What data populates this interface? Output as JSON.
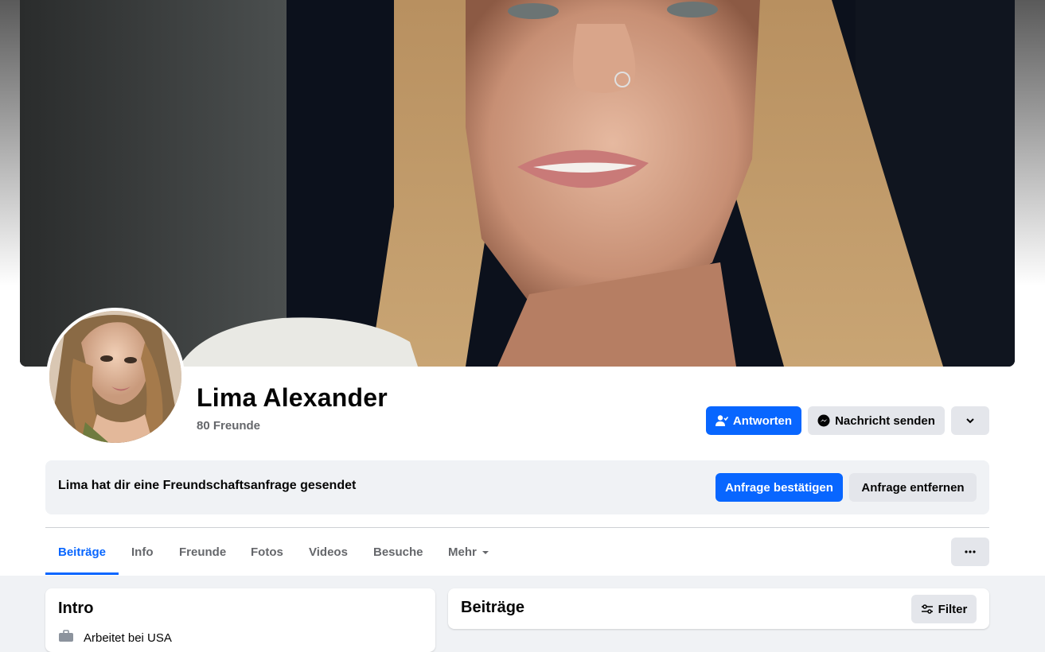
{
  "profile": {
    "name": "Lima Alexander",
    "friends_count": "80 Freunde"
  },
  "actions": {
    "reply_label": "Antworten",
    "message_label": "Nachricht senden"
  },
  "friend_request": {
    "text": "Lima hat dir eine Freundschaftsanfrage gesendet",
    "confirm_label": "Anfrage bestätigen",
    "remove_label": "Anfrage entfernen"
  },
  "tabs": [
    {
      "label": "Beiträge",
      "active": true
    },
    {
      "label": "Info",
      "active": false
    },
    {
      "label": "Freunde",
      "active": false
    },
    {
      "label": "Fotos",
      "active": false
    },
    {
      "label": "Videos",
      "active": false
    },
    {
      "label": "Besuche",
      "active": false
    },
    {
      "label": "Mehr",
      "active": false
    }
  ],
  "intro": {
    "title": "Intro",
    "work": "Arbeitet bei USA"
  },
  "posts": {
    "title": "Beiträge",
    "filter_label": "Filter"
  },
  "colors": {
    "primary": "#0866ff",
    "secondary_button": "#e4e6eb",
    "text_secondary": "#65676b",
    "page_background": "#f0f2f5"
  },
  "icons": {
    "reply": "person-check-icon",
    "message": "messenger-icon",
    "dropdown": "chevron-down-icon",
    "more": "more-dots-icon",
    "filter": "filter-sliders-icon",
    "work": "briefcase-icon"
  }
}
